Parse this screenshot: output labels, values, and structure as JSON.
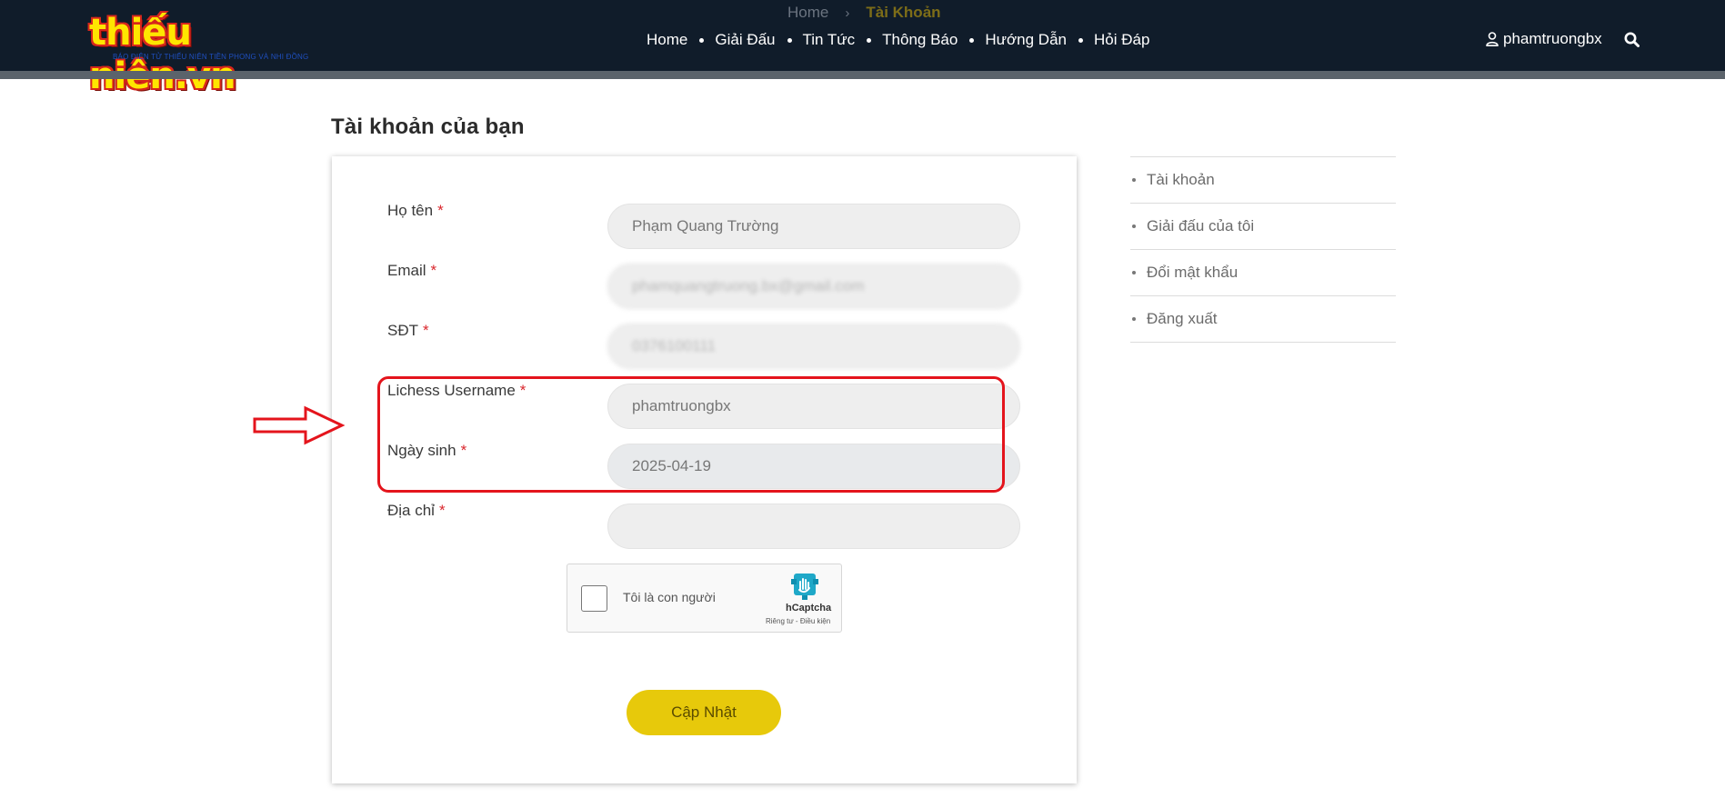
{
  "header": {
    "logo_text": "thiếu niên.vn",
    "logo_subtitle": "BÁO ĐIỆN TỬ THIẾU NIÊN TIỀN PHONG VÀ NHI ĐỒNG",
    "breadcrumb": {
      "home": "Home",
      "separator": "›",
      "current": "Tài Khoản"
    },
    "nav": [
      "Home",
      "Giải Đấu",
      "Tin Tức",
      "Thông Báo",
      "Hướng Dẫn",
      "Hỏi Đáp"
    ],
    "username": "phamtruongbx",
    "icons": {
      "user": "user-icon",
      "search": "search-icon"
    }
  },
  "page": {
    "title": "Tài khoản của bạn"
  },
  "form": {
    "required_mark": "*",
    "fields": [
      {
        "label": "Họ tên",
        "value": "Phạm Quang Trường"
      },
      {
        "label": "Email",
        "value": "phamquangtruong.bx@gmail.com"
      },
      {
        "label": "SĐT",
        "value": "0376100111"
      },
      {
        "label": "Lichess Username",
        "value": "phamtruongbx"
      },
      {
        "label": "Ngày sinh",
        "value": "2025-04-19"
      },
      {
        "label": "Địa chỉ",
        "value": ""
      }
    ],
    "captcha": {
      "label": "Tôi là con người",
      "brand": "hCaptcha",
      "links": "Riêng tư - Điều kiện"
    },
    "submit_label": "Cập Nhật"
  },
  "sidebar": {
    "items": [
      {
        "label": "Tài khoản"
      },
      {
        "label": "Giải đấu của tôi"
      },
      {
        "label": "Đổi mật khẩu"
      },
      {
        "label": "Đăng xuất"
      }
    ]
  },
  "colors": {
    "header_bg": "#101c2a",
    "accent_yellow": "#e7c90b",
    "required_red": "#d9262c",
    "annotation_red": "#e4141c"
  }
}
